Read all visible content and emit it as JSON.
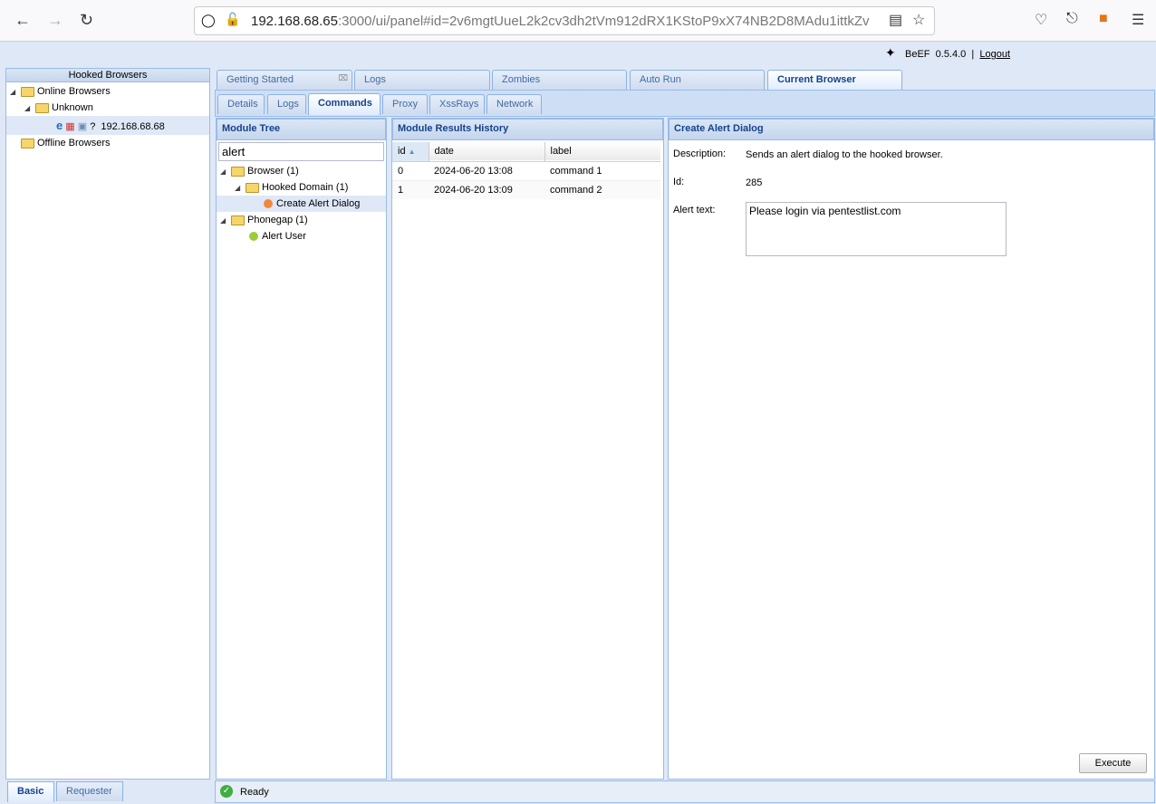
{
  "browser": {
    "url_host": "192.168.68.65",
    "url_rest": ":3000/ui/panel#id=2v6mgtUueL2k2cv3dh2tVm912dRX1KStoP9xX74NB2D8MAdu1ittkZv"
  },
  "header": {
    "app": "BeEF",
    "version": "0.5.4.0",
    "separator": "|",
    "logout": "Logout"
  },
  "left": {
    "title": "Hooked Browsers",
    "online": "Online Browsers",
    "unknown": "Unknown",
    "host": "192.168.68.68",
    "offline": "Offline Browsers",
    "host_icons": [
      "?"
    ],
    "tabs": [
      "Basic",
      "Requester"
    ]
  },
  "main_tabs": [
    "Getting Started",
    "Logs",
    "Zombies",
    "Auto Run",
    "Current Browser"
  ],
  "sub_tabs": [
    "Details",
    "Logs",
    "Commands",
    "Proxy",
    "XssRays",
    "Network"
  ],
  "module_tree": {
    "title": "Module Tree",
    "search": "alert",
    "items": [
      {
        "label": "Browser (1)"
      },
      {
        "label": "Hooked Domain (1)"
      },
      {
        "label": "Create Alert Dialog",
        "color": "#f0883a"
      },
      {
        "label": "Phonegap (1)"
      },
      {
        "label": "Alert User",
        "color": "#9ccc3c"
      }
    ]
  },
  "results": {
    "title": "Module Results History",
    "columns": [
      "id",
      "date",
      "label"
    ],
    "rows": [
      {
        "id": "0",
        "date": "2024-06-20 13:08",
        "label": "command 1"
      },
      {
        "id": "1",
        "date": "2024-06-20 13:09",
        "label": "command 2"
      }
    ]
  },
  "detail": {
    "title": "Create Alert Dialog",
    "description_label": "Description:",
    "description": "Sends an alert dialog to the hooked browser.",
    "id_label": "Id:",
    "id": "285",
    "alert_label": "Alert text:",
    "alert_text": "Please login via pentestlist.com",
    "execute": "Execute"
  },
  "status": {
    "text": "Ready"
  }
}
